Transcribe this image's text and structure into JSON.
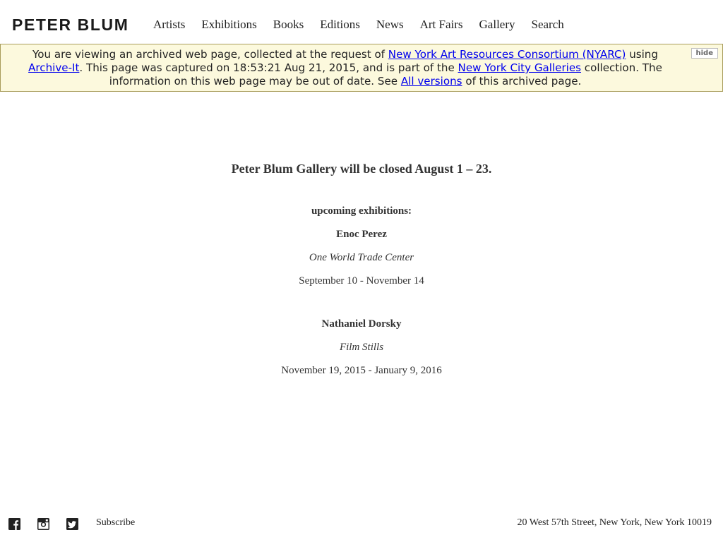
{
  "header": {
    "logo": "PETER BLUM",
    "nav": [
      "Artists",
      "Exhibitions",
      "Books",
      "Editions",
      "News",
      "Art Fairs",
      "Gallery",
      "Search"
    ]
  },
  "banner": {
    "t1": "You are viewing an archived web page, collected at the request of ",
    "link1": "New York Art Resources Consortium (NYARC)",
    "t2": " using ",
    "link2": "Archive-It",
    "t3": ". This page was captured on 18:53:21 Aug 21, 2015, and is part of the ",
    "link3": "New York City Galleries",
    "t4": " collection. The information on this web page may be out of date. See ",
    "link4": "All versions",
    "t5": " of this archived page.",
    "hide": "hide",
    "bg_color": "#fcf9dd"
  },
  "main": {
    "closed_notice": "Peter Blum Gallery will be closed August 1 – 23.",
    "upcoming_label": "upcoming exhibitions:",
    "exhibitions": [
      {
        "artist": "Enoc Perez",
        "title": "One World Trade Center",
        "dates": "September 10 - November 14"
      },
      {
        "artist": "Nathaniel Dorsky",
        "title": "Film Stills",
        "dates": "November 19, 2015 - January 9, 2016"
      }
    ]
  },
  "footer": {
    "social_icons": [
      "facebook-icon",
      "instagram-icon",
      "twitter-icon"
    ],
    "subscribe": "Subscribe",
    "address": "20 West 57th Street, New York, New York 10019"
  }
}
